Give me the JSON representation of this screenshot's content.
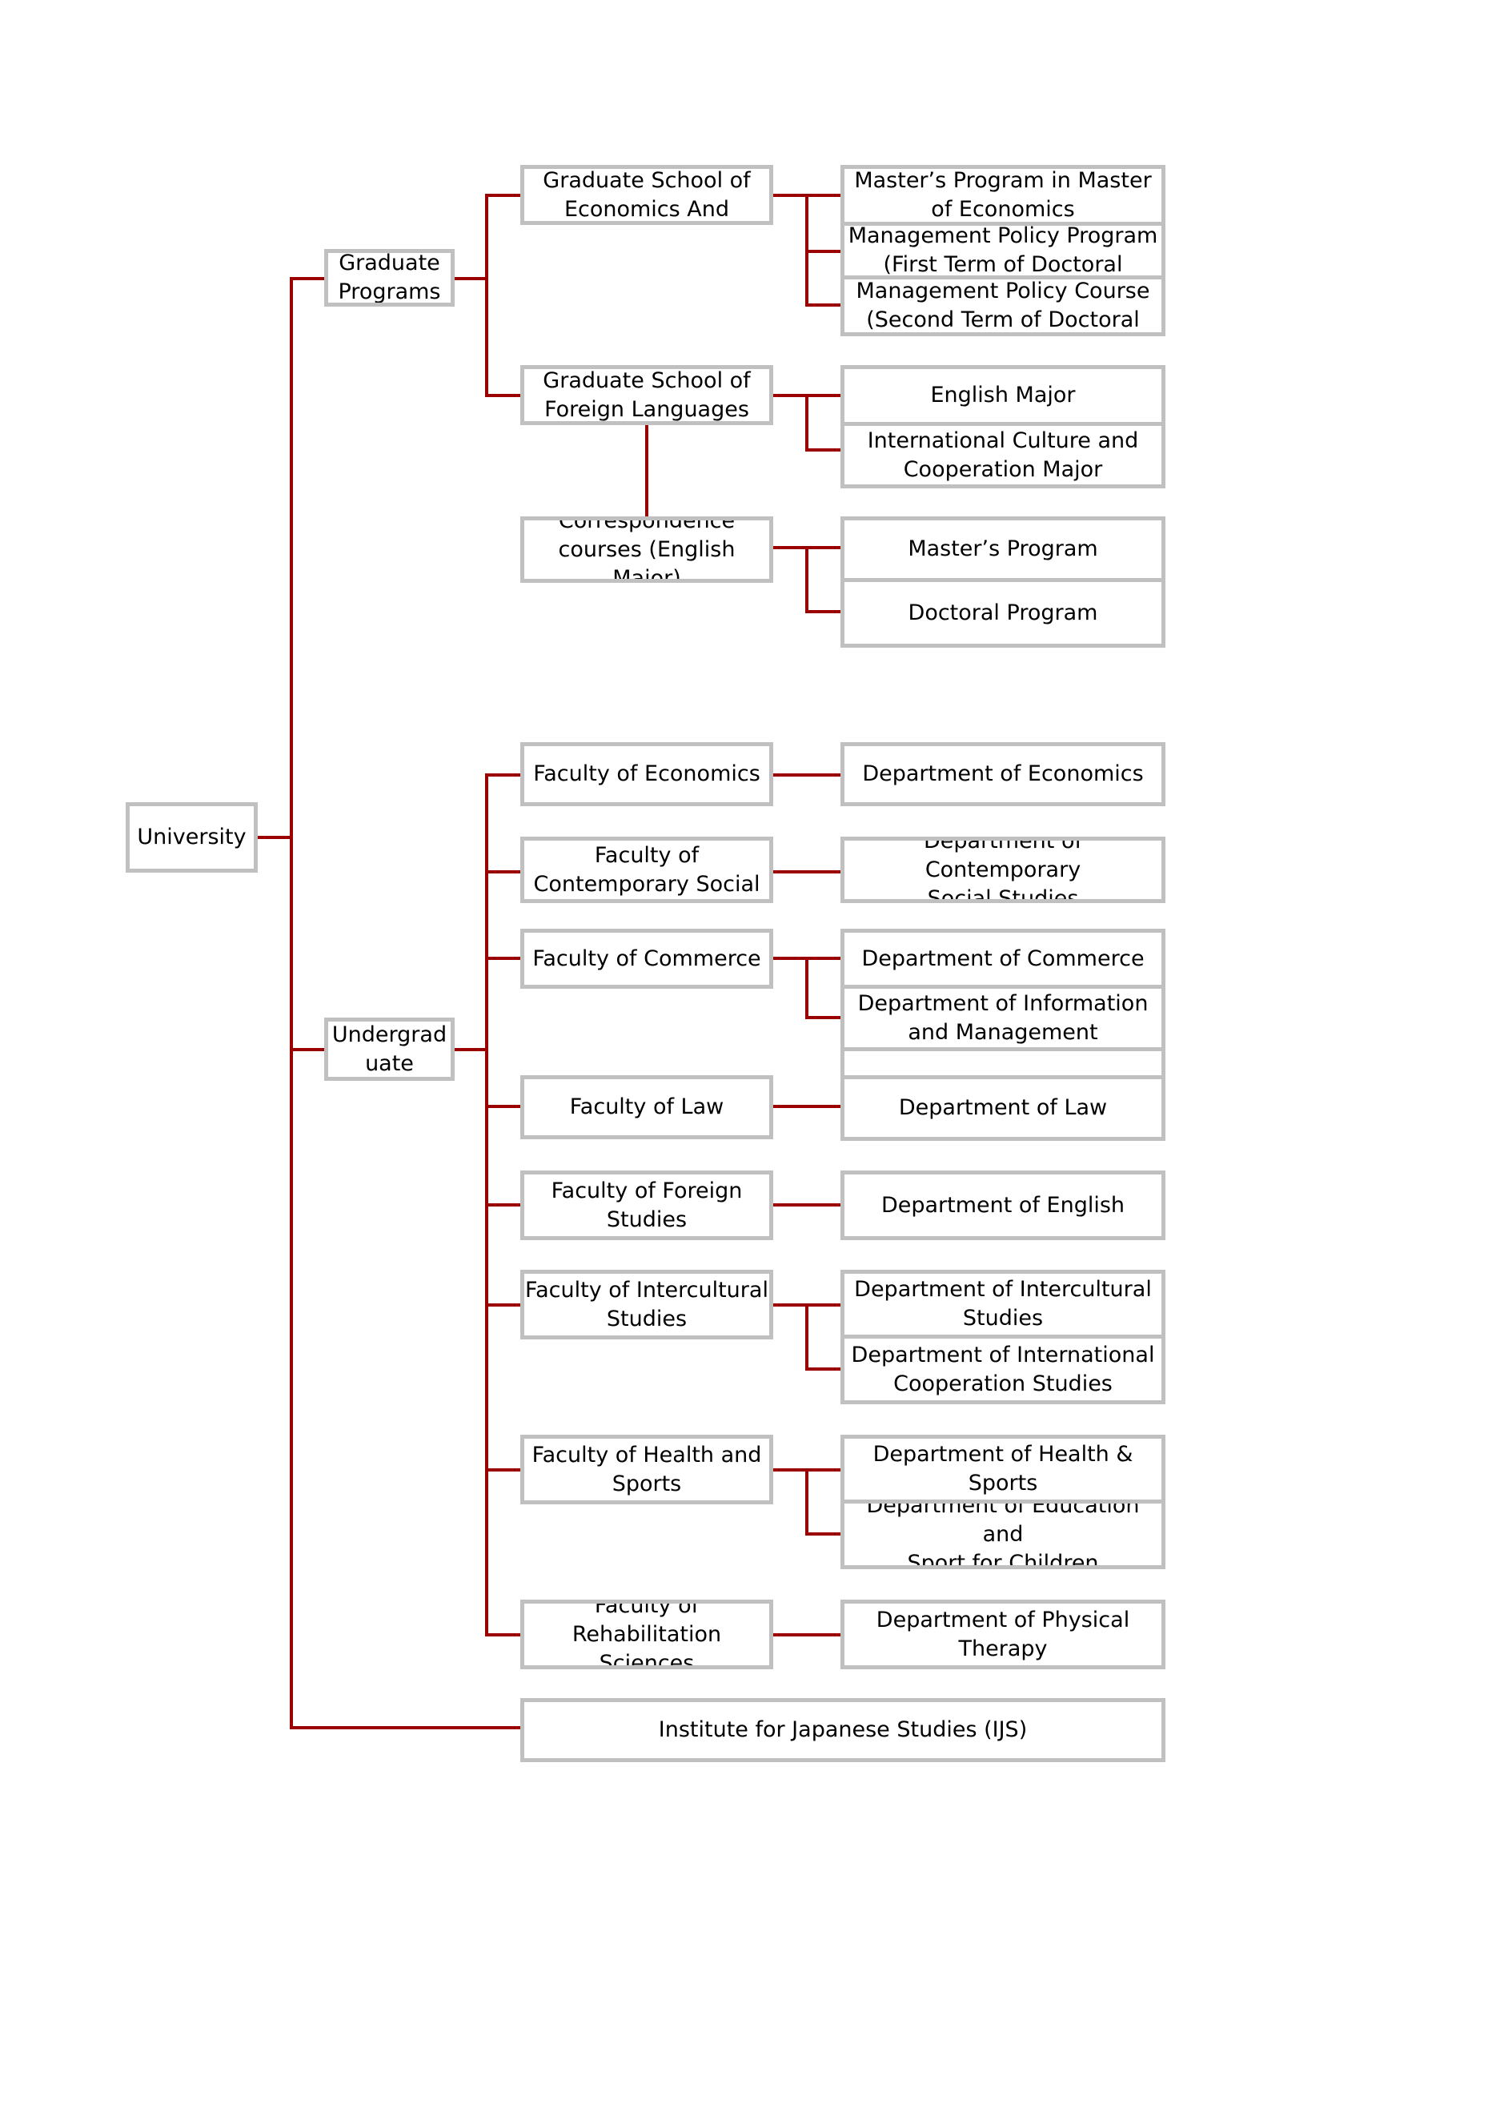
{
  "root": "University",
  "graduate": {
    "label": "Graduate\nPrograms",
    "schools": [
      {
        "label": "Graduate School of\nEconomics And",
        "programs": [
          "Master’s Program in Master\nof Economics",
          "Management Policy Program\n(First Term of Doctoral",
          "Management Policy Course\n(Second Term of Doctoral"
        ]
      },
      {
        "label": "Graduate School of\nForeign Languages",
        "programs": [
          "English Major",
          "International Culture and\nCooperation Major"
        ]
      },
      {
        "label": "Correspondence\ncourses (English Major)",
        "programs": [
          "Master’s Program",
          "Doctoral Program"
        ]
      }
    ]
  },
  "undergraduate": {
    "label": "Undergrad\nuate",
    "faculties": [
      {
        "label": "Faculty of Economics",
        "departments": [
          "Department of Economics"
        ]
      },
      {
        "label": "Faculty of\nContemporary Social",
        "departments": [
          "Department of Contemporary\nSocial Studies"
        ]
      },
      {
        "label": "Faculty of Commerce",
        "departments": [
          "Department of Commerce",
          "Department of Information\nand Management"
        ]
      },
      {
        "label": "Faculty of Law",
        "departments": [
          "Department of Law"
        ]
      },
      {
        "label": "Faculty of Foreign\nStudies",
        "departments": [
          "Department of English"
        ]
      },
      {
        "label": "Faculty of Intercultural\nStudies",
        "departments": [
          "Department of Intercultural\nStudies",
          "Department of International\nCooperation Studies"
        ]
      },
      {
        "label": "Faculty of Health and\nSports",
        "departments": [
          "Department of Health &\nSports",
          "Department of Education and\nSport for Children"
        ]
      },
      {
        "label": "Faculty of\nRehabilitation Sciences",
        "departments": [
          "Department of Physical\nTherapy"
        ]
      }
    ]
  },
  "institute": "Institute for Japanese Studies (IJS)",
  "colors": {
    "line": "#9a0000",
    "border": "#c0c0c0"
  }
}
